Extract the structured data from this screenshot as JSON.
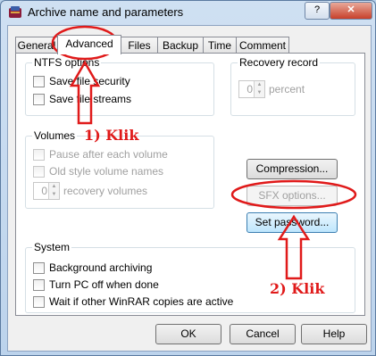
{
  "window": {
    "title": "Archive name and parameters",
    "help_glyph": "?",
    "close_glyph": "✕"
  },
  "tabs": [
    "General",
    "Advanced",
    "Files",
    "Backup",
    "Time",
    "Comment"
  ],
  "ntfs": {
    "label": "NTFS options",
    "save_security": "Save file security",
    "save_streams": "Save file streams"
  },
  "recovery": {
    "label": "Recovery record",
    "value": "0",
    "unit": "percent"
  },
  "volumes": {
    "label": "Volumes",
    "pause": "Pause after each volume",
    "old_style": "Old style volume names",
    "recovery_value": "0",
    "recovery_unit": "recovery volumes"
  },
  "buttons": {
    "compression": "Compression...",
    "sfx": "SFX options...",
    "password": "Set password...",
    "ok": "OK",
    "cancel": "Cancel",
    "help": "Help"
  },
  "system": {
    "label": "System",
    "background": "Background archiving",
    "turn_off": "Turn PC off when done",
    "wait": "Wait if other WinRAR copies are active"
  },
  "annotations": {
    "step1": "1) Klik",
    "step2": "2) Klik"
  },
  "colors": {
    "annotation": "#e01a1a"
  }
}
